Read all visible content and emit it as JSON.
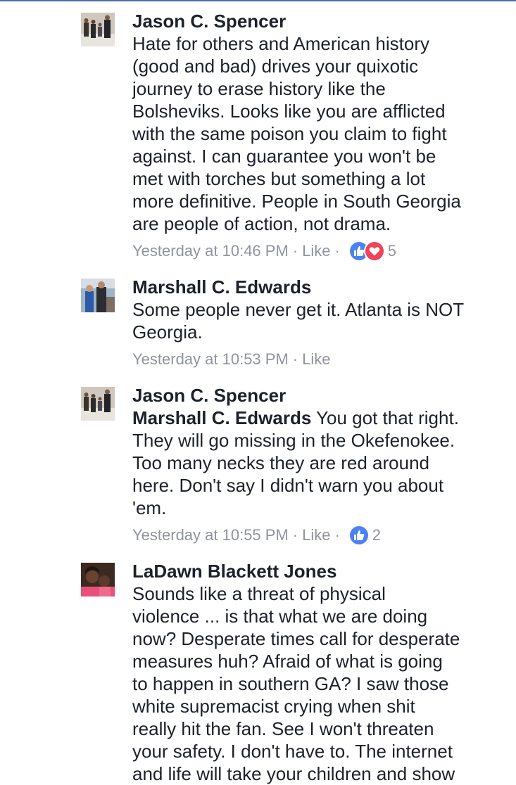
{
  "comments": [
    {
      "author": "Jason C. Spencer",
      "text": "Hate for others and American history\n(good and bad) drives your quixotic\njourney to erase history like the\nBolsheviks. Looks like you are afflicted\nwith the same poison you claim to fight\nagainst.  I can guarantee you won't be\nmet with torches but something a lot\nmore definitive. People in South Georgia\nare people of action, not drama.",
      "timestamp": "Yesterday at 10:46 PM",
      "like_label": "Like",
      "separator": "·",
      "reaction_count": "5",
      "reactions": [
        "thumbs-up-icon",
        "heart-icon"
      ]
    },
    {
      "author": "Marshall C. Edwards",
      "text": "Some people never get it. Atlanta is NOT\nGeorgia.",
      "timestamp": "Yesterday at 10:53 PM",
      "like_label": "Like",
      "separator": "·"
    },
    {
      "author": "Jason C. Spencer",
      "mention": "Marshall C. Edwards",
      "text": " You got that right.\nThey will go missing in the Okefenokee.\nToo many necks they are red around\nhere. Don't say I didn't warn you about\n'em.",
      "timestamp": "Yesterday at 10:55 PM",
      "like_label": "Like",
      "separator": "·",
      "reaction_count": "2",
      "reactions": [
        "thumbs-up-icon"
      ]
    },
    {
      "author": "LaDawn Blackett Jones",
      "text": "Sounds like a threat of physical\nviolence ... is that what we are doing\nnow? Desperate times call for desperate\nmeasures huh? Afraid of what is going\nto happen in southern GA? I saw those\nwhite supremacist crying when shit\nreally hit the fan. See I won't threaten\nyour safety. I don't have to. The internet\nand life will take your children and show"
    }
  ],
  "colors": {
    "text": "#1d2129",
    "meta": "#90949c",
    "like_reaction": "#4b83f0",
    "love_reaction": "#f0425a"
  }
}
